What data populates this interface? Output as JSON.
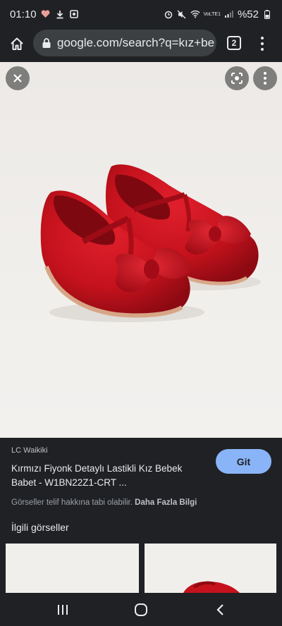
{
  "status_bar": {
    "time": "01:10",
    "battery": "%52",
    "network": "VoLTE1"
  },
  "browser": {
    "url": "google.com/search?q=kız+be",
    "tab_count": "2"
  },
  "viewer": {
    "close_icon": "close-icon",
    "lens_icon": "lens-icon",
    "more_icon": "more-vert-icon"
  },
  "info": {
    "source": "LC Waikiki",
    "title": "Kırmızı Fiyonk Detaylı Lastikli Kız Bebek Babet - W1BN22Z1-CRT ...",
    "copyright": "Görseller telif hakkına tabi olabilir.",
    "more_info": "Daha Fazla Bilgi",
    "visit_button": "Git"
  },
  "related": {
    "title": "İlgili görseller"
  },
  "colors": {
    "background": "#202124",
    "accent": "#8ab4f8",
    "shoe_red": "#c8121e"
  }
}
